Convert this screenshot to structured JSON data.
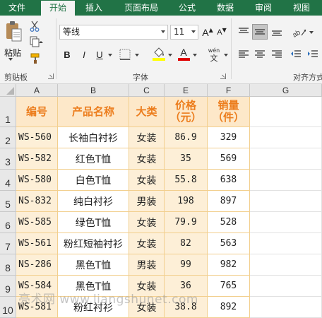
{
  "ribbon": {
    "tabs": [
      {
        "label": "文件",
        "active": false
      },
      {
        "label": "开始",
        "active": true
      },
      {
        "label": "插入",
        "active": false
      },
      {
        "label": "页面布局",
        "active": false
      },
      {
        "label": "公式",
        "active": false
      },
      {
        "label": "数据",
        "active": false
      },
      {
        "label": "审阅",
        "active": false
      },
      {
        "label": "视图",
        "active": false
      }
    ],
    "clipboard": {
      "paste_label": "粘贴",
      "group_label": "剪贴板"
    },
    "font": {
      "font_name": "等线",
      "font_size": "11",
      "bold": "B",
      "italic": "I",
      "underline": "U",
      "grow_font": "A",
      "shrink_font": "A",
      "font_color_letter": "A",
      "phonetic_top": "wén",
      "phonetic_bottom": "文",
      "group_label": "字体",
      "highlight_color": "#ffff00",
      "font_color": "#e00000"
    },
    "alignment": {
      "group_label": "对齐方式"
    }
  },
  "grid": {
    "corner": "",
    "columns": [
      "A",
      "B",
      "C",
      "E",
      "F",
      "G"
    ],
    "rows": [
      "1",
      "2",
      "3",
      "4",
      "5",
      "6",
      "7",
      "8",
      "9",
      "10"
    ],
    "header": {
      "code": "编号",
      "product": "产品名称",
      "category": "大类",
      "price_line1": "价格",
      "price_line2": "（元）",
      "sales_line1": "销量",
      "sales_line2": "（件）"
    },
    "data": [
      {
        "code": "WS-560",
        "product": "长袖白衬衫",
        "category": "女装",
        "price": "86.9",
        "sales": "329"
      },
      {
        "code": "WS-582",
        "product": "红色T恤",
        "category": "女装",
        "price": "35",
        "sales": "569"
      },
      {
        "code": "WS-580",
        "product": "白色T恤",
        "category": "女装",
        "price": "55.8",
        "sales": "638"
      },
      {
        "code": "NS-832",
        "product": "纯白衬衫",
        "category": "男装",
        "price": "198",
        "sales": "897"
      },
      {
        "code": "WS-585",
        "product": "绿色T恤",
        "category": "女装",
        "price": "79.9",
        "sales": "528"
      },
      {
        "code": "WS-561",
        "product": "粉红短袖衬衫",
        "category": "女装",
        "price": "82",
        "sales": "563"
      },
      {
        "code": "NS-286",
        "product": "黑色T恤",
        "category": "男装",
        "price": "99",
        "sales": "982"
      },
      {
        "code": "WS-584",
        "product": "黑色T恤",
        "category": "女装",
        "price": "36",
        "sales": "765"
      },
      {
        "code": "WS-581",
        "product": "粉红衬衫",
        "category": "女装",
        "price": "38.8",
        "sales": "892"
      }
    ]
  },
  "watermark": "亮术网 www.liangshunet.com",
  "colors": {
    "ribbon_green": "#217346",
    "header_fill": "#fde8c9",
    "header_text": "#ec7d1d",
    "band_fill": "#fdefd7",
    "border": "#f2cf8e"
  }
}
